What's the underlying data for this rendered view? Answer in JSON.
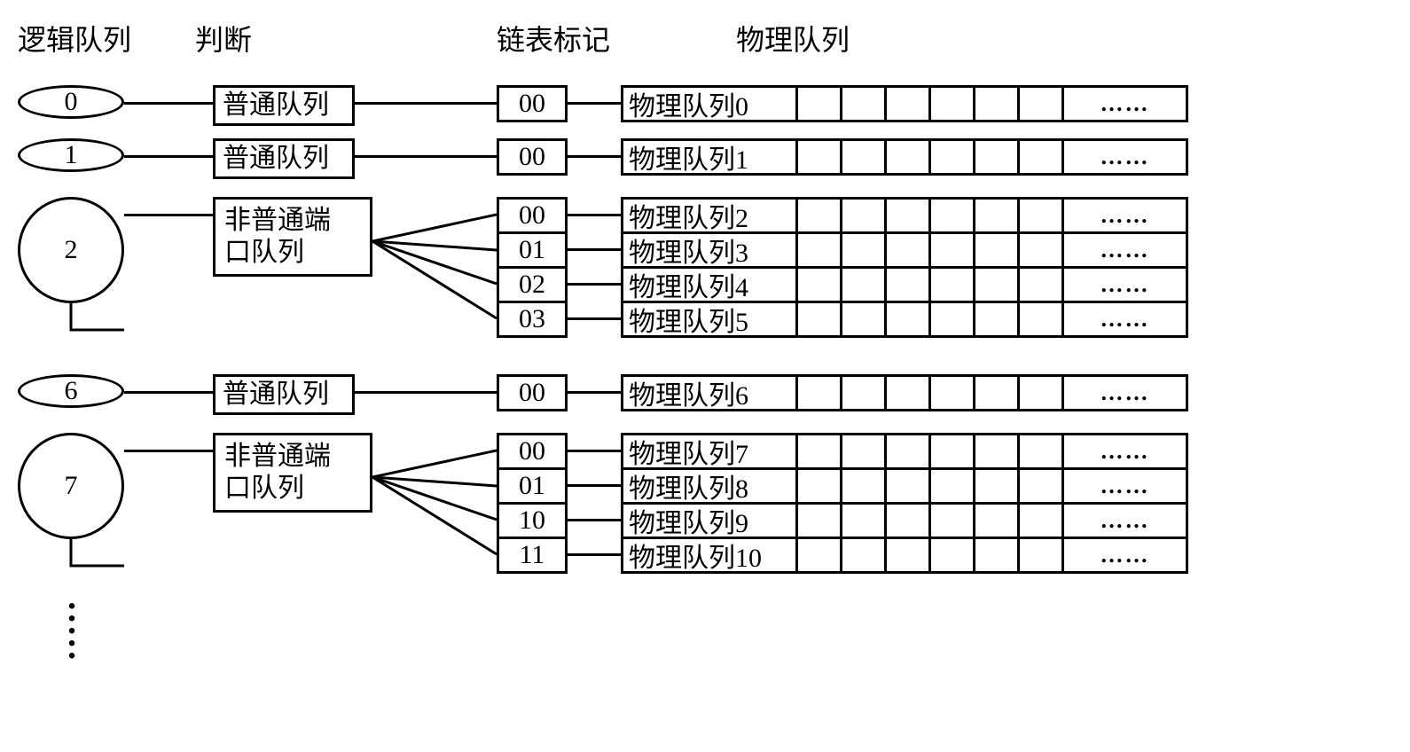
{
  "headers": {
    "logical": "逻辑队列",
    "judge": "判断",
    "mark": "链表标记",
    "physical": "物理队列"
  },
  "labels": {
    "normal_queue": "普通队列",
    "non_normal_port_queue_line1": "非普通端",
    "non_normal_port_queue_line2": "口队列",
    "ellipsis": "……"
  },
  "rows": [
    {
      "logical": "0",
      "judge_type": "normal",
      "marks": [
        "00"
      ],
      "phys": [
        "物理队列0"
      ]
    },
    {
      "logical": "1",
      "judge_type": "normal",
      "marks": [
        "00"
      ],
      "phys": [
        "物理队列1"
      ]
    },
    {
      "logical": "2",
      "judge_type": "multi",
      "marks": [
        "00",
        "01",
        "02",
        "03"
      ],
      "phys": [
        "物理队列2",
        "物理队列3",
        "物理队列4",
        "物理队列5"
      ]
    },
    {
      "logical": "6",
      "judge_type": "normal",
      "marks": [
        "00"
      ],
      "phys": [
        "物理队列6"
      ]
    },
    {
      "logical": "7",
      "judge_type": "multi",
      "marks": [
        "00",
        "01",
        "10",
        "11"
      ],
      "phys": [
        "物理队列7",
        "物理队列8",
        "物理队列9",
        "物理队列10"
      ]
    }
  ]
}
